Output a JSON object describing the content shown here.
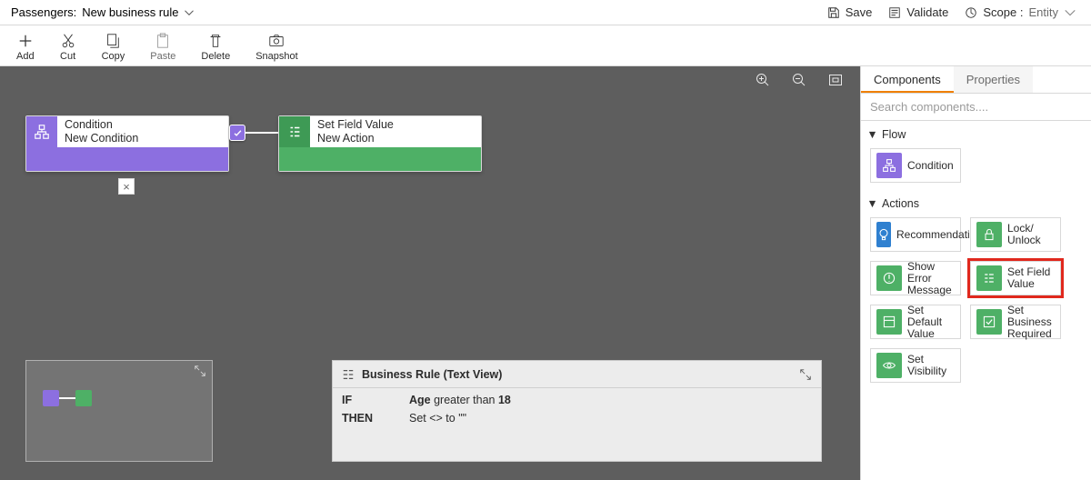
{
  "header": {
    "entity_label": "Passengers:",
    "rule_name": "New business rule",
    "save_label": "Save",
    "validate_label": "Validate",
    "scope_label": "Scope :",
    "scope_value": "Entity"
  },
  "toolbar": {
    "add": "Add",
    "cut": "Cut",
    "copy": "Copy",
    "paste": "Paste",
    "delete": "Delete",
    "snapshot": "Snapshot"
  },
  "canvas": {
    "condition_title": "Condition",
    "condition_sub": "New Condition",
    "action_title": "Set Field Value",
    "action_sub": "New Action",
    "delete_symbol": "×"
  },
  "text_view": {
    "title": "Business Rule (Text View)",
    "if_kw": "IF",
    "if_expr_pre": "Age",
    "if_expr_op": " greater than ",
    "if_expr_val": "18",
    "then_kw": "THEN",
    "then_expr": "Set <> to \"\""
  },
  "panel": {
    "tab_components": "Components",
    "tab_properties": "Properties",
    "search_placeholder": "Search components....",
    "group_flow": "Flow",
    "group_actions": "Actions",
    "tiles": {
      "condition": "Condition",
      "recommendation": "Recommendation",
      "lock_unlock": "Lock/\nUnlock",
      "show_error": "Show Error Message",
      "set_field_value": "Set Field Value",
      "set_default": "Set Default Value",
      "set_required": "Set Business Required",
      "set_visibility": "Set Visibility"
    }
  }
}
